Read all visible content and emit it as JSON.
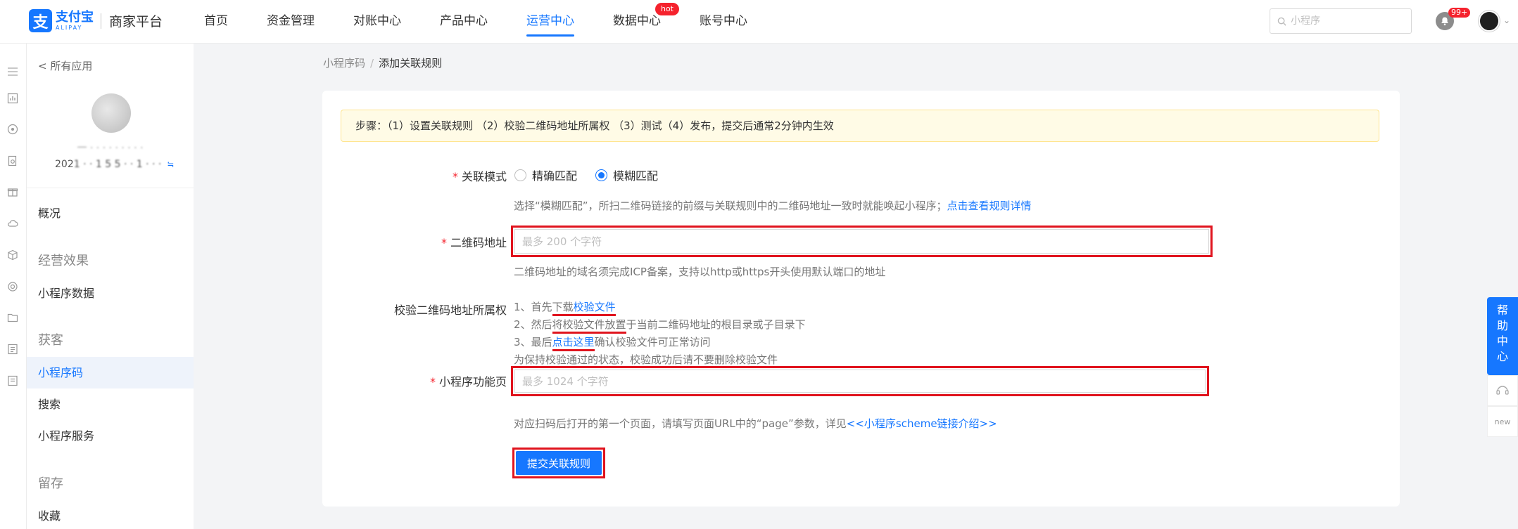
{
  "brand": {
    "logo_glyph": "支",
    "name_cn": "支付宝",
    "name_en": "ALIPAY",
    "platform": "商家平台",
    "color": "#1677ff"
  },
  "nav": {
    "items": [
      {
        "label": "首页",
        "active": false
      },
      {
        "label": "资金管理",
        "active": false
      },
      {
        "label": "对账中心",
        "active": false
      },
      {
        "label": "产品中心",
        "active": false
      },
      {
        "label": "运营中心",
        "active": true
      },
      {
        "label": "数据中心",
        "active": false,
        "badge": "hot"
      },
      {
        "label": "账号中心",
        "active": false
      }
    ]
  },
  "top": {
    "search_placeholder": "小程序",
    "notification_count": "99+"
  },
  "sidebar": {
    "back_label": "< 所有应用",
    "app_name": "一 · · · ·  · · · · ·",
    "app_id_prefix": "202",
    "app_id_blurred": "1 ·  · 1 5 5 · · 1 · · ·",
    "copy_glyph": "≒",
    "items": [
      {
        "label": "概况",
        "type": "item"
      },
      {
        "label": "经营效果",
        "type": "group"
      },
      {
        "label": "小程序数据",
        "type": "item"
      },
      {
        "label": "获客",
        "type": "group"
      },
      {
        "label": "小程序码",
        "type": "item",
        "active": true
      },
      {
        "label": "搜索",
        "type": "item"
      },
      {
        "label": "小程序服务",
        "type": "item"
      },
      {
        "label": "留存",
        "type": "group"
      },
      {
        "label": "收藏",
        "type": "item"
      }
    ]
  },
  "breadcrumb": {
    "parent": "小程序码",
    "separator": "/",
    "current": "添加关联规则"
  },
  "steps_text": "步骤：（1）设置关联规则 （2）校验二维码地址所属权 （3）测试（4）发布，提交后通常2分钟内生效",
  "form": {
    "mode": {
      "label": "关联模式",
      "required": "*",
      "options": [
        "精确匹配",
        "模糊匹配"
      ],
      "selected": "模糊匹配",
      "help": "选择“模糊匹配”，所扫二维码链接的前缀与关联规则中的二维码地址一致时就能唤起小程序；",
      "help_link": "点击查看规则详情"
    },
    "qr_url": {
      "label": "二维码地址",
      "required": "*",
      "placeholder": "最多 200 个字符",
      "value": "",
      "help": "二维码地址的域名须完成ICP备案，支持以http或https开头使用默认端口的地址"
    },
    "verify": {
      "label": "校验二维码地址所属权",
      "line1_pre": "1、首先",
      "line1_ul": "下载",
      "line1_link": "校验文件",
      "line2_pre": "2、然后",
      "line2_ul": "将校验文件放置",
      "line2_post": "于当前二维码地址的根目录或子目录下",
      "line3_pre": "3、最后",
      "line3_link": "点击这里",
      "line3_post": "确认校验文件可正常访问",
      "line4": "为保持校验通过的状态，校验成功后请不要删除校验文件"
    },
    "page": {
      "label": "小程序功能页",
      "required": "*",
      "placeholder": "最多 1024 个字符",
      "value": "",
      "help": "对应扫码后打开的第一个页面，请填写页面URL中的“page”参数，详见",
      "help_link": "<<小程序scheme链接介绍>>"
    },
    "submit_label": "提交关联规则"
  },
  "help_float": {
    "chars": [
      "帮",
      "助",
      "中",
      "心"
    ],
    "new_label": "new"
  },
  "colors": {
    "primary": "#1677ff",
    "annotation_red": "#e0141e",
    "required": "#f5222d",
    "alert_bg": "#fffbe6"
  }
}
